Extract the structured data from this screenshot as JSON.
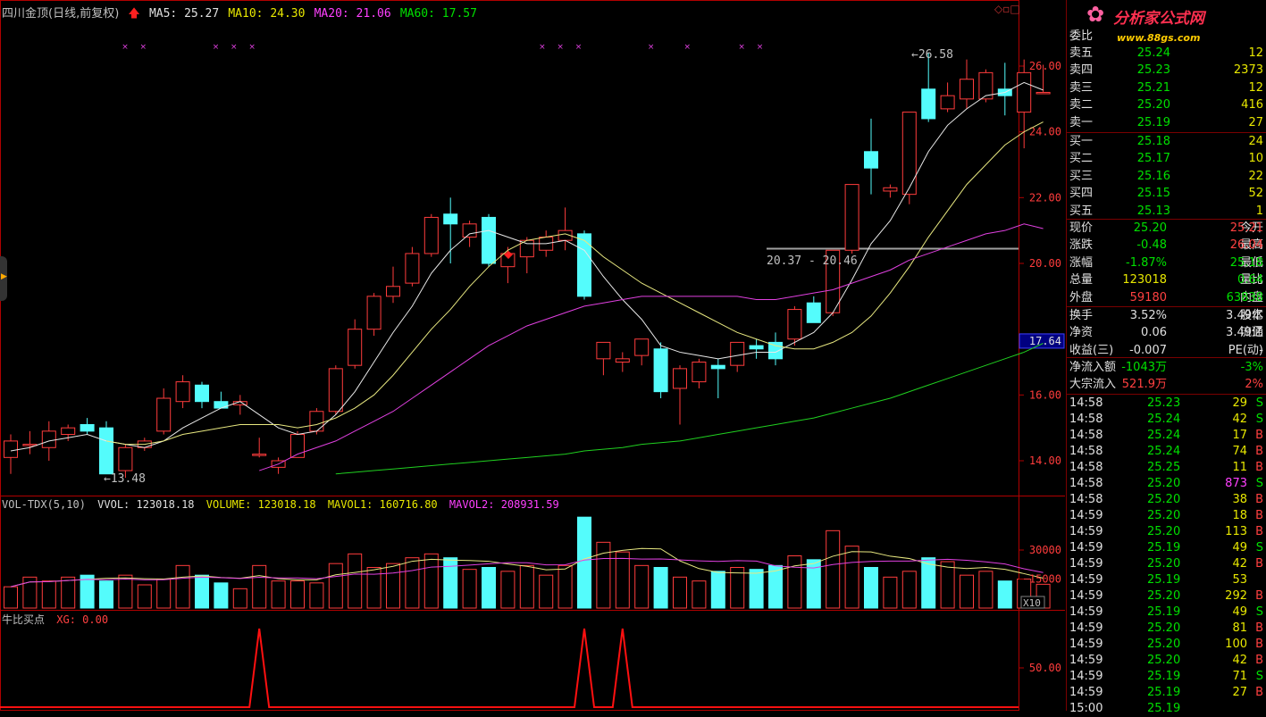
{
  "header": {
    "title": "四川金顶(日线,前复权)",
    "ma5": "MA5: 25.27",
    "ma10": "MA10: 24.30",
    "ma20": "MA20: 21.06",
    "ma60": "MA60: 17.57"
  },
  "price_axis": [
    "26.00",
    "24.00",
    "22.00",
    "20.00",
    "17.64",
    "16.00",
    "14.00"
  ],
  "annotations": {
    "high": "26.58",
    "low": "13.48",
    "range": "20.37 - 20.46"
  },
  "volume_header": {
    "name": "VOL-TDX(5,10)",
    "vvol": "VVOL: 123018.18",
    "volume": "VOLUME: 123018.18",
    "mavol1": "MAVOL1: 160716.80",
    "mavol2": "MAVOL2: 208931.59"
  },
  "volume_axis": [
    "30000",
    "15000",
    "X10"
  ],
  "indicator_header": {
    "name": "牛比买点",
    "xg": "XG: 0.00"
  },
  "indicator_axis": [
    "50.00"
  ],
  "logo": {
    "text": "分析家公式网",
    "url_text": "www.88gs.com"
  },
  "order_book": {
    "title": "委比",
    "sells": [
      {
        "label": "卖五",
        "price": "25.24",
        "vol": "12"
      },
      {
        "label": "卖四",
        "price": "25.23",
        "vol": "2373"
      },
      {
        "label": "卖三",
        "price": "25.21",
        "vol": "12"
      },
      {
        "label": "卖二",
        "price": "25.20",
        "vol": "416"
      },
      {
        "label": "卖一",
        "price": "25.19",
        "vol": "27"
      }
    ],
    "buys": [
      {
        "label": "买一",
        "price": "25.18",
        "vol": "24"
      },
      {
        "label": "买二",
        "price": "25.17",
        "vol": "10"
      },
      {
        "label": "买三",
        "price": "25.16",
        "vol": "22"
      },
      {
        "label": "买四",
        "price": "25.15",
        "vol": "52"
      },
      {
        "label": "买五",
        "price": "25.13",
        "vol": "1"
      }
    ]
  },
  "quote": [
    {
      "l1": "现价",
      "v1": "25.20",
      "l2": "今开",
      "v2": "25.21",
      "c1": "green",
      "c2": "red"
    },
    {
      "l1": "涨跌",
      "v1": "-0.48",
      "l2": "最高",
      "v2": "26.04",
      "c1": "green",
      "c2": "red"
    },
    {
      "l1": "涨幅",
      "v1": "-1.87%",
      "l2": "最低",
      "v2": "25.18",
      "c1": "green",
      "c2": "green"
    },
    {
      "l1": "总量",
      "v1": "123018",
      "l2": "量比",
      "v2": "0.64",
      "c1": "yellow",
      "c2": "green"
    },
    {
      "l1": "外盘",
      "v1": "59180",
      "l2": "内盘",
      "v2": "63838",
      "c1": "red",
      "c2": "green"
    },
    {
      "l1": "换手",
      "v1": "3.52%",
      "l2": "股本",
      "v2": "3.49亿",
      "c1": "white",
      "c2": "white"
    },
    {
      "l1": "净资",
      "v1": "0.06",
      "l2": "流通",
      "v2": "3.49亿",
      "c1": "white",
      "c2": "white"
    },
    {
      "l1": "收益(三)",
      "v1": "-0.007",
      "l2": "PE(动)",
      "v2": "-",
      "c1": "white",
      "c2": "white"
    }
  ],
  "flows": [
    {
      "label": "净流入额",
      "v1": "-1043万",
      "v2": "-3%",
      "color": "green"
    },
    {
      "label": "大宗流入",
      "v1": "521.9万",
      "v2": "2%",
      "color": "red"
    }
  ],
  "ticks": [
    {
      "t": "14:58",
      "p": "25.23",
      "v": "29",
      "s": "S"
    },
    {
      "t": "14:58",
      "p": "25.24",
      "v": "42",
      "s": "S"
    },
    {
      "t": "14:58",
      "p": "25.24",
      "v": "17",
      "s": "B"
    },
    {
      "t": "14:58",
      "p": "25.24",
      "v": "74",
      "s": "B"
    },
    {
      "t": "14:58",
      "p": "25.25",
      "v": "11",
      "s": "B"
    },
    {
      "t": "14:58",
      "p": "25.20",
      "v": "873",
      "s": "S"
    },
    {
      "t": "14:58",
      "p": "25.20",
      "v": "38",
      "s": "B"
    },
    {
      "t": "14:59",
      "p": "25.20",
      "v": "18",
      "s": "B"
    },
    {
      "t": "14:59",
      "p": "25.20",
      "v": "113",
      "s": "B"
    },
    {
      "t": "14:59",
      "p": "25.19",
      "v": "49",
      "s": "S"
    },
    {
      "t": "14:59",
      "p": "25.20",
      "v": "42",
      "s": "B"
    },
    {
      "t": "14:59",
      "p": "25.19",
      "v": "53",
      "s": ""
    },
    {
      "t": "14:59",
      "p": "25.20",
      "v": "292",
      "s": "B"
    },
    {
      "t": "14:59",
      "p": "25.19",
      "v": "49",
      "s": "S"
    },
    {
      "t": "14:59",
      "p": "25.20",
      "v": "81",
      "s": "B"
    },
    {
      "t": "14:59",
      "p": "25.20",
      "v": "100",
      "s": "B"
    },
    {
      "t": "14:59",
      "p": "25.20",
      "v": "42",
      "s": "B"
    },
    {
      "t": "14:59",
      "p": "25.19",
      "v": "71",
      "s": "S"
    },
    {
      "t": "14:59",
      "p": "25.19",
      "v": "27",
      "s": "B"
    },
    {
      "t": "15:00",
      "p": "25.19",
      "v": "",
      "s": ""
    }
  ],
  "candles": [
    {
      "o": 14.1,
      "h": 14.8,
      "l": 13.6,
      "c": 14.6
    },
    {
      "o": 14.5,
      "h": 14.9,
      "l": 14.2,
      "c": 14.5
    },
    {
      "o": 14.4,
      "h": 15.2,
      "l": 14.0,
      "c": 14.9
    },
    {
      "o": 14.8,
      "h": 15.1,
      "l": 14.6,
      "c": 15.0
    },
    {
      "o": 15.1,
      "h": 15.3,
      "l": 14.8,
      "c": 14.9
    },
    {
      "o": 15.0,
      "h": 15.2,
      "l": 13.7,
      "c": 13.6
    },
    {
      "o": 13.7,
      "h": 14.5,
      "l": 13.48,
      "c": 14.4
    },
    {
      "o": 14.4,
      "h": 14.7,
      "l": 14.3,
      "c": 14.6
    },
    {
      "o": 14.9,
      "h": 16.2,
      "l": 14.8,
      "c": 15.9
    },
    {
      "o": 15.8,
      "h": 16.6,
      "l": 15.6,
      "c": 16.4
    },
    {
      "o": 16.3,
      "h": 16.4,
      "l": 15.6,
      "c": 15.8
    },
    {
      "o": 15.8,
      "h": 16.1,
      "l": 15.6,
      "c": 15.6
    },
    {
      "o": 15.7,
      "h": 16.0,
      "l": 15.4,
      "c": 15.8
    },
    {
      "o": 14.2,
      "h": 14.7,
      "l": 14.1,
      "c": 14.2
    },
    {
      "o": 13.8,
      "h": 14.1,
      "l": 13.6,
      "c": 14.0
    },
    {
      "o": 14.1,
      "h": 14.9,
      "l": 14.1,
      "c": 14.8
    },
    {
      "o": 14.9,
      "h": 15.6,
      "l": 14.8,
      "c": 15.5
    },
    {
      "o": 15.5,
      "h": 16.9,
      "l": 15.4,
      "c": 16.8
    },
    {
      "o": 16.9,
      "h": 18.3,
      "l": 16.8,
      "c": 18.0
    },
    {
      "o": 18.0,
      "h": 19.1,
      "l": 17.8,
      "c": 19.0
    },
    {
      "o": 19.0,
      "h": 19.9,
      "l": 18.8,
      "c": 19.3
    },
    {
      "o": 19.4,
      "h": 20.5,
      "l": 19.3,
      "c": 20.3
    },
    {
      "o": 20.3,
      "h": 21.5,
      "l": 20.2,
      "c": 21.4
    },
    {
      "o": 21.5,
      "h": 22.0,
      "l": 20.0,
      "c": 21.2
    },
    {
      "o": 20.8,
      "h": 21.3,
      "l": 20.5,
      "c": 21.2
    },
    {
      "o": 21.4,
      "h": 21.5,
      "l": 19.9,
      "c": 20.0
    },
    {
      "o": 19.9,
      "h": 20.5,
      "l": 19.4,
      "c": 20.3
    },
    {
      "o": 20.2,
      "h": 20.8,
      "l": 19.7,
      "c": 20.7
    },
    {
      "o": 20.4,
      "h": 21.0,
      "l": 20.2,
      "c": 20.8
    },
    {
      "o": 20.7,
      "h": 21.7,
      "l": 20.4,
      "c": 21.0
    },
    {
      "o": 20.9,
      "h": 21.0,
      "l": 18.9,
      "c": 19.0
    },
    {
      "o": 17.1,
      "h": 17.6,
      "l": 16.6,
      "c": 17.6
    },
    {
      "o": 17.0,
      "h": 17.3,
      "l": 16.7,
      "c": 17.1
    },
    {
      "o": 17.2,
      "h": 17.7,
      "l": 16.9,
      "c": 17.7
    },
    {
      "o": 17.4,
      "h": 17.6,
      "l": 15.9,
      "c": 16.1
    },
    {
      "o": 16.2,
      "h": 16.9,
      "l": 15.1,
      "c": 16.8
    },
    {
      "o": 16.4,
      "h": 17.1,
      "l": 16.2,
      "c": 17.0
    },
    {
      "o": 16.9,
      "h": 17.1,
      "l": 15.9,
      "c": 16.8
    },
    {
      "o": 16.9,
      "h": 17.5,
      "l": 16.7,
      "c": 17.6
    },
    {
      "o": 17.5,
      "h": 17.7,
      "l": 17.1,
      "c": 17.4
    },
    {
      "o": 17.6,
      "h": 17.9,
      "l": 16.9,
      "c": 17.1
    },
    {
      "o": 17.7,
      "h": 18.7,
      "l": 17.5,
      "c": 18.6
    },
    {
      "o": 18.8,
      "h": 19.0,
      "l": 18.2,
      "c": 18.2
    },
    {
      "o": 18.5,
      "h": 20.4,
      "l": 18.4,
      "c": 20.4
    },
    {
      "o": 20.4,
      "h": 22.4,
      "l": 20.3,
      "c": 22.4
    },
    {
      "o": 23.4,
      "h": 24.4,
      "l": 22.1,
      "c": 22.9
    },
    {
      "o": 22.2,
      "h": 22.4,
      "l": 22.0,
      "c": 22.3
    },
    {
      "o": 22.1,
      "h": 24.6,
      "l": 21.8,
      "c": 24.6
    },
    {
      "o": 25.3,
      "h": 26.4,
      "l": 24.3,
      "c": 24.4
    },
    {
      "o": 24.7,
      "h": 25.5,
      "l": 24.6,
      "c": 25.1
    },
    {
      "o": 25.0,
      "h": 26.2,
      "l": 24.7,
      "c": 25.6
    },
    {
      "o": 25.0,
      "h": 25.9,
      "l": 24.9,
      "c": 25.8
    },
    {
      "o": 25.3,
      "h": 26.1,
      "l": 24.5,
      "c": 25.1
    },
    {
      "o": 24.6,
      "h": 26.2,
      "l": 23.5,
      "c": 25.8
    },
    {
      "o": 25.2,
      "h": 26.04,
      "l": 25.18,
      "c": 25.2
    }
  ],
  "ma_lines": {
    "ma5": [
      14.3,
      14.4,
      14.6,
      14.7,
      14.8,
      14.6,
      14.5,
      14.4,
      14.6,
      15.0,
      15.3,
      15.6,
      15.8,
      15.4,
      15.0,
      14.8,
      14.9,
      15.4,
      16.1,
      17.0,
      17.9,
      18.7,
      19.7,
      20.4,
      20.9,
      21.0,
      20.8,
      20.6,
      20.6,
      20.7,
      20.4,
      19.6,
      18.9,
      18.3,
      17.5,
      17.3,
      17.2,
      17.1,
      17.2,
      17.3,
      17.3,
      17.6,
      17.9,
      18.5,
      19.5,
      20.6,
      21.3,
      22.3,
      23.4,
      24.2,
      24.7,
      25.1,
      25.2,
      25.5,
      25.27
    ],
    "ma10": [
      null,
      null,
      null,
      null,
      null,
      14.6,
      14.5,
      14.5,
      14.6,
      14.8,
      14.9,
      15.0,
      15.1,
      15.1,
      15.1,
      15.0,
      15.1,
      15.3,
      15.6,
      16.0,
      16.6,
      17.3,
      18.0,
      18.6,
      19.3,
      19.9,
      20.4,
      20.7,
      20.8,
      20.9,
      20.7,
      20.2,
      19.8,
      19.4,
      19.1,
      18.8,
      18.5,
      18.2,
      17.9,
      17.7,
      17.5,
      17.4,
      17.4,
      17.6,
      17.9,
      18.4,
      19.1,
      19.9,
      20.8,
      21.6,
      22.4,
      23.0,
      23.6,
      24.0,
      24.3
    ],
    "ma20": [
      null,
      null,
      null,
      null,
      null,
      null,
      null,
      null,
      null,
      null,
      null,
      null,
      null,
      13.7,
      13.9,
      14.2,
      14.4,
      14.6,
      14.9,
      15.2,
      15.5,
      15.9,
      16.3,
      16.7,
      17.1,
      17.5,
      17.8,
      18.1,
      18.3,
      18.5,
      18.7,
      18.8,
      18.9,
      19.0,
      19.0,
      19.0,
      19.0,
      19.0,
      19.0,
      18.9,
      18.9,
      19.0,
      19.1,
      19.2,
      19.4,
      19.6,
      19.8,
      20.1,
      20.3,
      20.5,
      20.7,
      20.9,
      21.0,
      21.2,
      21.06
    ],
    "ma60": [
      null,
      null,
      null,
      null,
      null,
      null,
      null,
      null,
      null,
      null,
      null,
      null,
      null,
      null,
      null,
      null,
      null,
      13.6,
      13.65,
      13.7,
      13.75,
      13.8,
      13.85,
      13.9,
      13.95,
      14.0,
      14.05,
      14.1,
      14.15,
      14.2,
      14.3,
      14.35,
      14.4,
      14.5,
      14.55,
      14.6,
      14.7,
      14.8,
      14.9,
      15.0,
      15.1,
      15.2,
      15.3,
      15.45,
      15.6,
      15.75,
      15.9,
      16.1,
      16.3,
      16.5,
      16.7,
      16.9,
      17.1,
      17.3,
      17.57
    ]
  },
  "volumes": [
    11000,
    16000,
    14000,
    16000,
    17000,
    14000,
    17000,
    12000,
    15000,
    22000,
    17000,
    13000,
    10000,
    22000,
    14000,
    14000,
    13000,
    23000,
    28000,
    21000,
    23000,
    26000,
    28000,
    26000,
    20000,
    21000,
    19000,
    22000,
    17000,
    22000,
    47000,
    34000,
    29000,
    22000,
    21000,
    16000,
    14000,
    19000,
    21000,
    20000,
    22000,
    27000,
    25000,
    40000,
    32000,
    21000,
    16000,
    19000,
    26000,
    24000,
    17000,
    19000,
    14000,
    15000,
    12300
  ],
  "signals": [
    13,
    30,
    32
  ],
  "marks_x": [
    0,
    1,
    5,
    6,
    7,
    23,
    24,
    25,
    29,
    31,
    34,
    35
  ]
}
